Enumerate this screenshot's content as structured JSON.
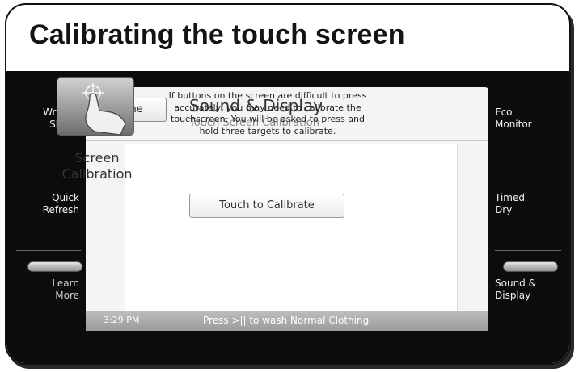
{
  "header": {
    "title": "Calibrating the touch screen"
  },
  "sidebar_left": [
    {
      "label": "Wrinkle\nShield"
    },
    {
      "label": "Quick\nRefresh"
    },
    {
      "label": "Learn\nMore"
    }
  ],
  "sidebar_right": [
    {
      "label": "Eco\nMonitor"
    },
    {
      "label": "Timed\nDry"
    },
    {
      "label": "Sound &\nDisplay"
    }
  ],
  "dialog": {
    "done_label": "Done",
    "title": "Sound & Display",
    "subtitle": "Touch Screen Calibration",
    "calibration_label": "Screen\nCalibration",
    "description": "If buttons on the screen are difficult to press accurately, you may need to calibrate the touchscreen. You will be asked to press and hold three targets to calibrate.",
    "touch_button": "Touch to Calibrate"
  },
  "status_bar": {
    "time": "3:29 PM",
    "message": "Press >|| to wash Normal Clothing"
  },
  "icons": {
    "done": "chevron-left-icon",
    "calibration": "hand-touch-target-icon"
  }
}
